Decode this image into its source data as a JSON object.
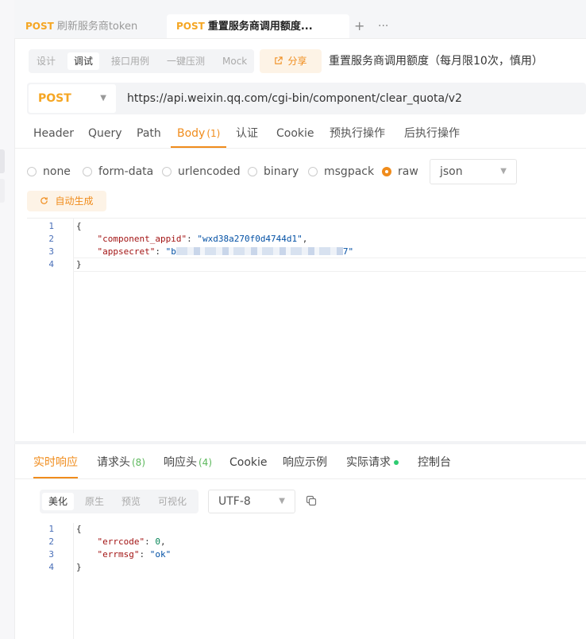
{
  "tabs": [
    {
      "method": "POST",
      "label": "刷新服务商token"
    },
    {
      "method": "POST",
      "label": "重置服务商调用额度..."
    }
  ],
  "tab_actions": {
    "add": "+",
    "more": "···"
  },
  "modes": [
    "设计",
    "调试",
    "接口用例",
    "一键压测",
    "Mock"
  ],
  "active_mode": "调试",
  "share_label": "分享",
  "request_title": "重置服务商调用额度（每月限10次，慎用）",
  "request": {
    "method": "POST",
    "url": "https://api.weixin.qq.com/cgi-bin/component/clear_quota/v2"
  },
  "request_tabs": [
    {
      "label": "Header"
    },
    {
      "label": "Query"
    },
    {
      "label": "Path"
    },
    {
      "label": "Body",
      "count": "(1)"
    },
    {
      "label": "认证"
    },
    {
      "label": "Cookie"
    },
    {
      "label": "预执行操作"
    },
    {
      "label": "后执行操作"
    }
  ],
  "body_types": [
    "none",
    "form-data",
    "urlencoded",
    "binary",
    "msgpack",
    "raw"
  ],
  "selected_body_type": "raw",
  "body_format": "json",
  "autogen_label": "自动生成",
  "request_body": {
    "line_numbers": [
      "1",
      "2",
      "3",
      "4"
    ],
    "open_brace": "{",
    "close_brace": "}",
    "key1": "\"component_appid\"",
    "val1": "\"wxd38a270f0d4744d1\"",
    "key2": "\"appsecret\"",
    "val2_prefix": "\"b",
    "val2_suffix": "7\""
  },
  "response_tabs": [
    {
      "label": "实时响应"
    },
    {
      "label": "请求头",
      "count": "(8)"
    },
    {
      "label": "响应头",
      "count": "(4)"
    },
    {
      "label": "Cookie"
    },
    {
      "label": "响应示例"
    },
    {
      "label": "实际请求"
    },
    {
      "label": "控制台"
    }
  ],
  "view_modes": [
    "美化",
    "原生",
    "预览",
    "可视化"
  ],
  "encoding": "UTF-8",
  "response_body": {
    "line_numbers": [
      "1",
      "2",
      "3",
      "4"
    ],
    "open_brace": "{",
    "close_brace": "}",
    "key1": "\"errcode\"",
    "val1": "0",
    "key2": "\"errmsg\"",
    "val2": "\"ok\""
  }
}
